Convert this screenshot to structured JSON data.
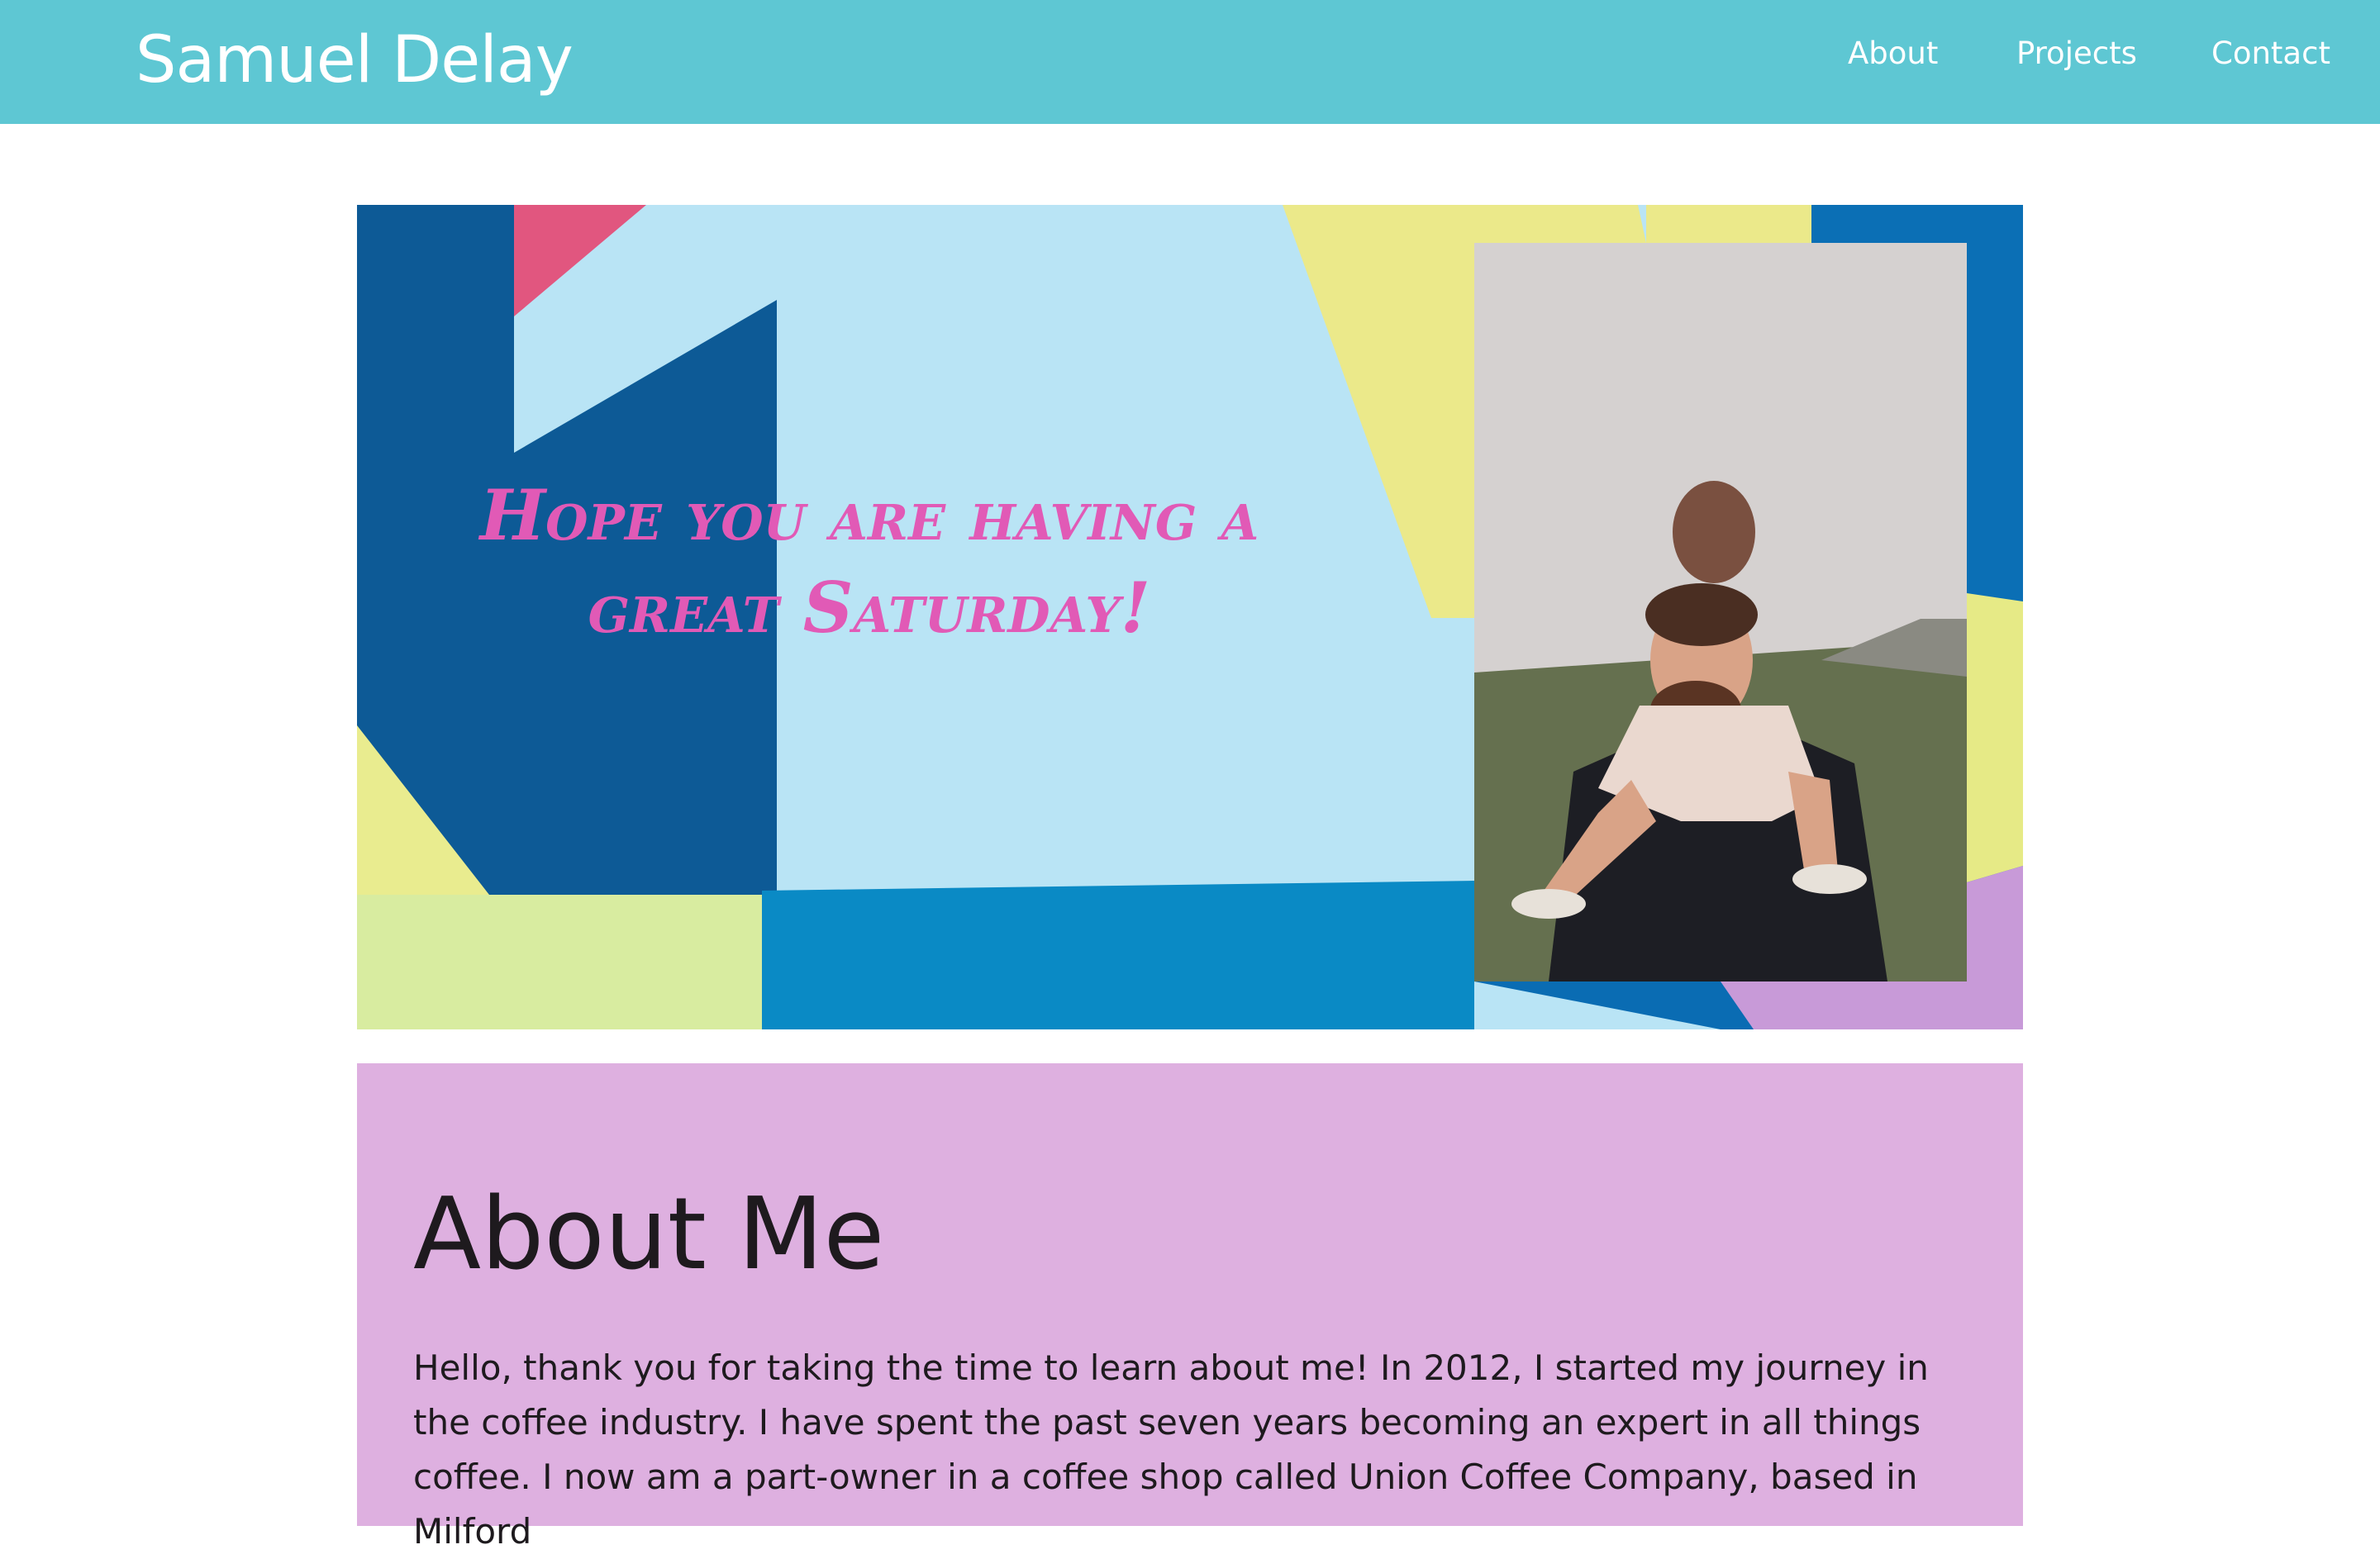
{
  "header": {
    "site_title": "Samuel Delay",
    "nav": [
      {
        "label": "About"
      },
      {
        "label": "Projects"
      },
      {
        "label": "Contact"
      }
    ],
    "background_color": "#5ec7d3"
  },
  "hero": {
    "greeting": "Hope you are having a great Saturday!",
    "greeting_color": "#e15ab6",
    "photo_icon": "person-with-child-on-shoulders-photo"
  },
  "about": {
    "title": "About Me",
    "body": "Hello, thank you for taking the time to learn about me! In 2012, I started my journey in the coffee industry. I have spent the past seven years becoming an expert in all things coffee. I now am a part-owner in a coffee shop called Union Coffee Company, based in Milford",
    "background_color": "#deb0e0"
  }
}
